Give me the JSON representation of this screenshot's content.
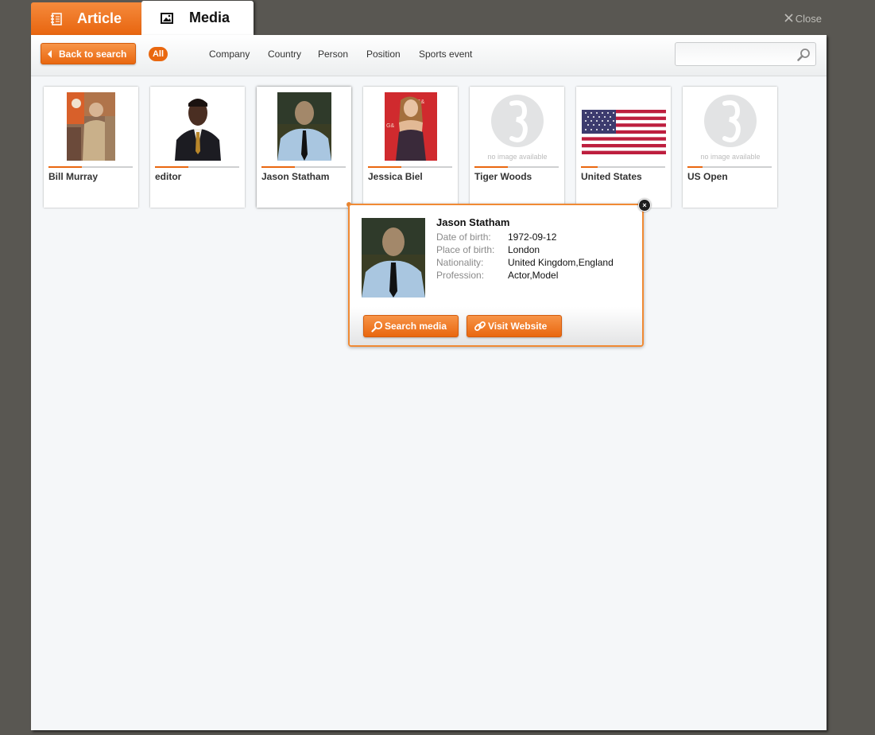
{
  "tabs": [
    {
      "label": "Article",
      "icon": "notebook-icon",
      "active": false
    },
    {
      "label": "Media",
      "icon": "image-icon",
      "active": true
    }
  ],
  "close_label": "Close",
  "toolbar": {
    "back_label": "Back to search",
    "all_label": "All",
    "filters": [
      "Company",
      "Country",
      "Person",
      "Position",
      "Sports event"
    ],
    "search_placeholder": ""
  },
  "cards": [
    {
      "name": "Bill Murray",
      "relevance": 0.4,
      "image": "photo"
    },
    {
      "name": "editor",
      "relevance": 0.4,
      "image": "photo"
    },
    {
      "name": "Jason Statham",
      "relevance": 0.4,
      "image": "photo"
    },
    {
      "name": "Jessica Biel",
      "relevance": 0.4,
      "image": "photo"
    },
    {
      "name": "Tiger Woods",
      "relevance": 0.4,
      "image": "placeholder",
      "placeholder_text": "no image available"
    },
    {
      "name": "United States",
      "relevance": 0.2,
      "image": "us-flag"
    },
    {
      "name": "US Open",
      "relevance": 0.18,
      "image": "placeholder",
      "placeholder_text": "no image available"
    }
  ],
  "popup": {
    "name": "Jason Statham",
    "fields": [
      {
        "label": "Date of birth:",
        "value": "1972-09-12"
      },
      {
        "label": "Place of birth:",
        "value": "London"
      },
      {
        "label": "Nationality:",
        "value": "United Kingdom,England"
      },
      {
        "label": "Profession:",
        "value": "Actor,Model"
      }
    ],
    "search_media_label": "Search media",
    "visit_website_label": "Visit Website"
  },
  "colors": {
    "accent": "#e9670f",
    "background": "#595752",
    "panel": "#f5f7f9"
  }
}
